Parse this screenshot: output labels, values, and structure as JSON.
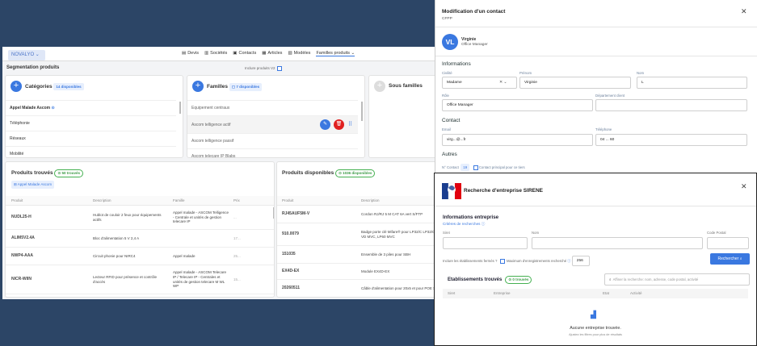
{
  "app": {
    "brand": "NOVALYO",
    "nav": [
      {
        "icon": "document-icon",
        "label": "Devis"
      },
      {
        "icon": "building-icon",
        "label": "Sociétés"
      },
      {
        "icon": "contact-card-icon",
        "label": "Contacts"
      },
      {
        "icon": "box-icon",
        "label": "Articles"
      },
      {
        "icon": "grid-icon",
        "label": "Modèles"
      },
      {
        "icon": "",
        "label": "Familles produits"
      }
    ],
    "segment_title": "Segmentation produits",
    "include_label": "Inclure produits V2",
    "categories": {
      "title": "Catégories",
      "count": "14 disponibles",
      "items": [
        "Appel Malade Ascom",
        "Téléphonie",
        "Réseaux",
        "Mobilité"
      ]
    },
    "familles": {
      "title": "Familles",
      "count": "7 disponibles",
      "items": [
        "Equipement centraux",
        "Ascom telligence actif",
        "Ascom telligence passif",
        "Ascom telecare IP Blabs"
      ]
    },
    "sous_familles": {
      "title": "Sous familles"
    },
    "produits_trouves": {
      "title": "Produits trouvés",
      "count": "50 trouvés",
      "filter": "Appel Malade Ascom",
      "headers": [
        "Produit",
        "Description",
        "Famille",
        "Prix"
      ],
      "rows": [
        {
          "produit": "NUDL25-H",
          "description": "Hublot de couloir 2 feux pour équipements actifs",
          "famille": "Appel malade - ASCOM Telligence - Centrale et unités de gestion telecare IP",
          "prix": "..."
        },
        {
          "produit": "ALIM5V2.4A",
          "description": "Bloc d'alimentation 5 V 2,4 A",
          "famille": "",
          "prix": "17..."
        },
        {
          "produit": "NWP4-AAA",
          "description": "Circuit phonie pour NIRC4",
          "famille": "Appel malade",
          "prix": "25..."
        },
        {
          "produit": "NICR-WIIN",
          "description": "Lecteur RFID pour présence et contrôle d'accès",
          "famille": "Appel malade - ASCOM Telecare IP / Telecare IP - Centrales et unités de gestion telecare M WL WP",
          "prix": "15..."
        }
      ]
    },
    "produits_disponibles": {
      "title": "Produits disponibles",
      "count": "1036 disponibles",
      "headers": [
        "Produit",
        "Description"
      ],
      "rows": [
        {
          "produit": "RJ45AUF5M-V",
          "description": "Cordon RJ/RJ 5 M CAT 6A vert S/FTP"
        },
        {
          "produit": "910.0079",
          "description": "Badge porte clé Mifare® pour LP32/C LP32/C AV, VD MVC, LP60 MVC"
        },
        {
          "produit": "151035",
          "description": "Ensemble de 3 piles pour SBH"
        },
        {
          "produit": "EX4D-EX",
          "description": "Module EX4D-EX"
        },
        {
          "produit": "20260511",
          "description": "Câble d'alimentation pour 20x5 et pour POE SIP"
        }
      ]
    }
  },
  "contact_modal": {
    "title": "Modification d'un contact",
    "subtitle": "CFPP",
    "avatar_initials": "VL",
    "name": "Virginie",
    "role": "Office Manager",
    "informations_label": "Informations",
    "civilite_label": "Civilité",
    "civilite_value": "Madame",
    "prenom_label": "Prénom",
    "prenom_value": "Virginie",
    "nom_label": "Nom",
    "nom_value": "L",
    "role_label": "Rôle",
    "role_value": "Office Manager",
    "departement_label": "Département client",
    "departement_value": "",
    "contact_label": "Contact",
    "email_label": "Email",
    "email_value": "virg...@...fr",
    "telephone_label": "Téléphone",
    "telephone_value": "04 ... 60",
    "autres_label": "Autres",
    "no_contact_label": "N° Contact",
    "no_contact_value": "19",
    "principal_label": "Contact principal pour ce tiers"
  },
  "sirene_modal": {
    "title": "Recherche d'entreprise SIRENE",
    "info_label": "Informations entreprise",
    "criteres_label": "Critères de recherches",
    "siret_label": "Siret",
    "nom_label": "Nom",
    "cp_label": "Code Postal",
    "inclure_label": "Inclure les établissements fermés ?",
    "max_label": "Maximum d'enregistrements recherché",
    "max_value": "256",
    "search_button": "Rechercher",
    "etab_title": "Etablissements trouvés",
    "etab_count": "0 trouvés",
    "filter_placeholder": "Affiner la recherche: nom, adresse, code postal, activité",
    "headers": [
      "Siret",
      "Entreprise",
      "Etat",
      "Activité"
    ],
    "empty_title": "Aucune entreprise trouvée.",
    "empty_sub": "Ajustez les filtres pour plus de résultats"
  }
}
